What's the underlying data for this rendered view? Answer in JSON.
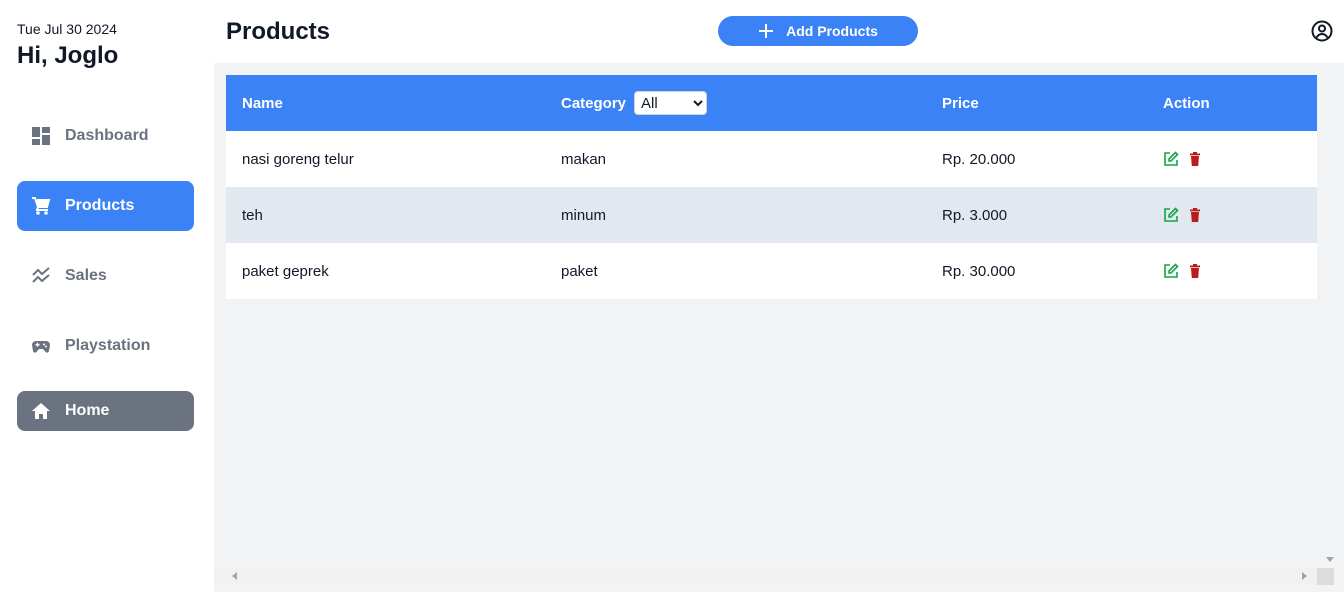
{
  "sidebar": {
    "date": "Tue Jul 30 2024",
    "greeting": "Hi, Joglo",
    "items": [
      {
        "label": "Dashboard",
        "icon": "dashboard-icon"
      },
      {
        "label": "Products",
        "icon": "cart-icon",
        "active": true
      },
      {
        "label": "Sales",
        "icon": "trend-icon"
      },
      {
        "label": "Playstation",
        "icon": "gamepad-icon"
      },
      {
        "label": "Home",
        "icon": "home-icon"
      }
    ]
  },
  "header": {
    "title": "Products",
    "add_button_label": "Add Products",
    "user_icon": "user-circle-icon"
  },
  "table": {
    "columns": {
      "name": "Name",
      "category": "Category",
      "price": "Price",
      "action": "Action"
    },
    "category_filter": {
      "selected": "All"
    },
    "rows": [
      {
        "name": "nasi goreng telur",
        "category": "makan",
        "price": "Rp. 20.000"
      },
      {
        "name": "teh",
        "category": "minum",
        "price": "Rp. 3.000"
      },
      {
        "name": "paket geprek",
        "category": "paket",
        "price": "Rp. 30.000"
      }
    ]
  },
  "colors": {
    "accent": "#3b82f6",
    "home_button": "#6b7280",
    "edit_icon": "#16a34a",
    "delete_icon": "#b91c1c",
    "alt_row": "#e2e8f0"
  }
}
